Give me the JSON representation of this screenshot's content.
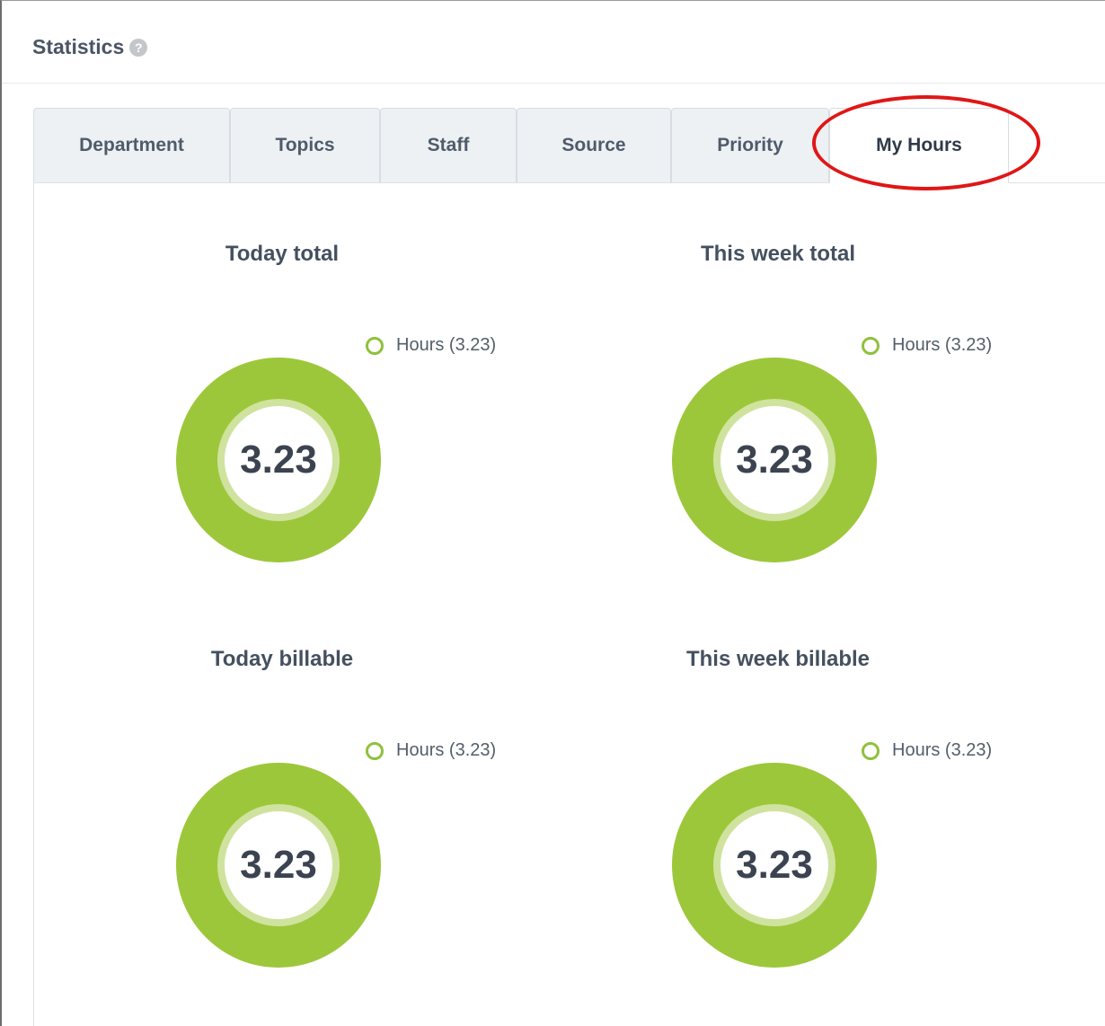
{
  "header": {
    "title": "Statistics",
    "help_glyph": "?"
  },
  "tabs": [
    {
      "label": "Department",
      "active": false
    },
    {
      "label": "Topics",
      "active": false
    },
    {
      "label": "Staff",
      "active": false
    },
    {
      "label": "Source",
      "active": false
    },
    {
      "label": "Priority",
      "active": false
    },
    {
      "label": "My Hours",
      "active": true
    }
  ],
  "colors": {
    "donut_fill": "#9dc73a",
    "donut_inner_ring": "#cfe39f",
    "legend_marker": "#8fc13c",
    "annotation": "#e01616"
  },
  "panels": [
    {
      "title": "Today total",
      "legend": "Hours (3.23)",
      "value": "3.23"
    },
    {
      "title": "This week total",
      "legend": "Hours (3.23)",
      "value": "3.23"
    },
    {
      "title": "Today billable",
      "legend": "Hours (3.23)",
      "value": "3.23"
    },
    {
      "title": "This week billable",
      "legend": "Hours (3.23)",
      "value": "3.23"
    }
  ],
  "chart_data": [
    {
      "type": "pie",
      "title": "Today total",
      "categories": [
        "Hours"
      ],
      "values": [
        3.23
      ],
      "legend": [
        "Hours (3.23)"
      ],
      "center_label": "3.23"
    },
    {
      "type": "pie",
      "title": "This week total",
      "categories": [
        "Hours"
      ],
      "values": [
        3.23
      ],
      "legend": [
        "Hours (3.23)"
      ],
      "center_label": "3.23"
    },
    {
      "type": "pie",
      "title": "Today billable",
      "categories": [
        "Hours"
      ],
      "values": [
        3.23
      ],
      "legend": [
        "Hours (3.23)"
      ],
      "center_label": "3.23"
    },
    {
      "type": "pie",
      "title": "This week billable",
      "categories": [
        "Hours"
      ],
      "values": [
        3.23
      ],
      "legend": [
        "Hours (3.23)"
      ],
      "center_label": "3.23"
    }
  ]
}
